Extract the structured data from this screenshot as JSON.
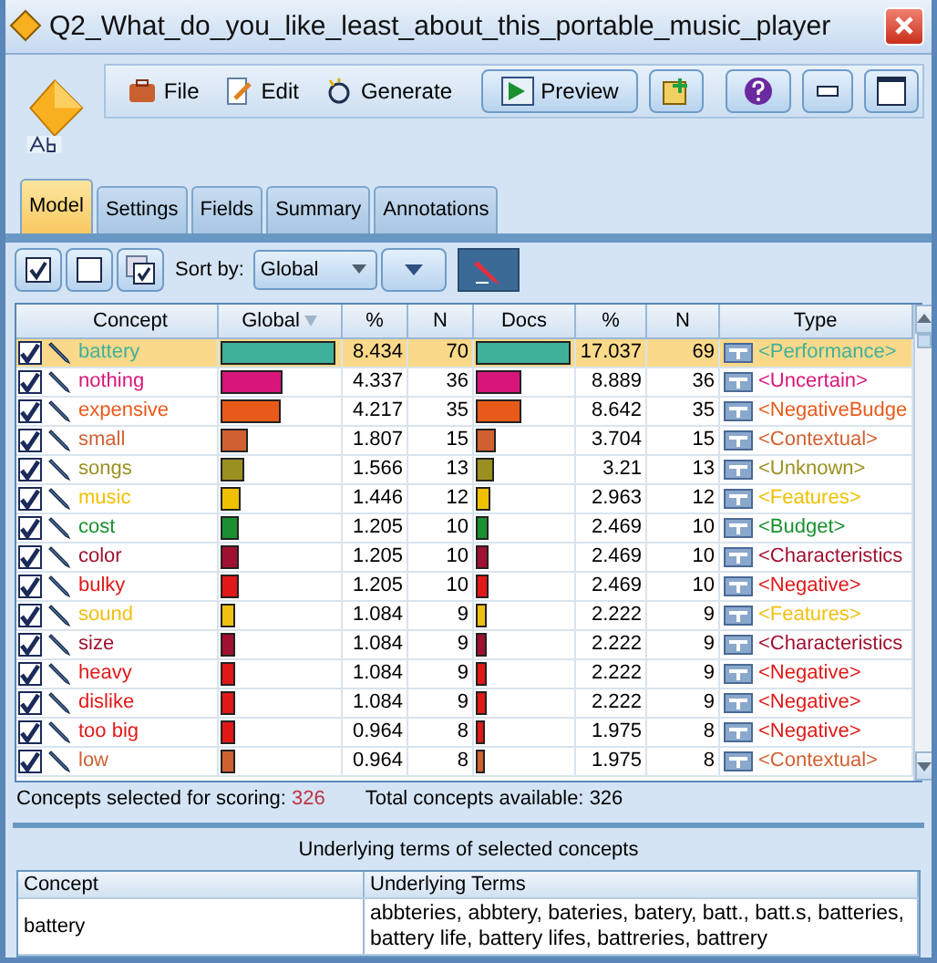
{
  "window": {
    "title": "Q2_What_do_you_like_least_about_this_portable_music_player"
  },
  "menu": [
    {
      "label": "File",
      "kind": "file"
    },
    {
      "label": "Edit",
      "kind": "edit"
    },
    {
      "label": "Generate",
      "kind": "generate"
    }
  ],
  "preview_button": {
    "label": "Preview"
  },
  "tabs": [
    {
      "label": "Model",
      "selected": true
    },
    {
      "label": "Settings",
      "selected": false
    },
    {
      "label": "Fields",
      "selected": false
    },
    {
      "label": "Summary",
      "selected": false
    },
    {
      "label": "Annotations",
      "selected": false
    }
  ],
  "sort": {
    "label": "Sort by:",
    "value": "Global"
  },
  "table": {
    "columns": [
      "Concept",
      "Global",
      "%",
      "N",
      "Docs",
      "%",
      "N",
      "Type"
    ],
    "rows": [
      {
        "concept": "battery",
        "color": "#3fb09a",
        "global_bar": {
          "level": 0.97
        },
        "pct": "8.434",
        "n": "70",
        "docs_bar": {
          "level": 0.98
        },
        "docs_pct": "17.037",
        "docs_n": "69",
        "type": "<Performance>",
        "checked": true,
        "selected": true
      },
      {
        "concept": "nothing",
        "color": "#d8157a",
        "global_bar": {
          "level": 0.52
        },
        "pct": "4.337",
        "n": "36",
        "docs_bar": {
          "level": 0.48
        },
        "docs_pct": "8.889",
        "docs_n": "36",
        "type": "<Uncertain>",
        "checked": true,
        "selected": false
      },
      {
        "concept": "expensive",
        "color": "#e85a1a",
        "global_bar": {
          "level": 0.5
        },
        "pct": "4.217",
        "n": "35",
        "docs_bar": {
          "level": 0.47
        },
        "docs_pct": "8.642",
        "docs_n": "35",
        "type": "<NegativeBudge",
        "checked": true,
        "selected": false
      },
      {
        "concept": "small",
        "color": "#d06030",
        "global_bar": {
          "level": 0.23
        },
        "pct": "1.807",
        "n": "15",
        "docs_bar": {
          "level": 0.2
        },
        "docs_pct": "3.704",
        "docs_n": "15",
        "type": "<Contextual>",
        "checked": true,
        "selected": false
      },
      {
        "concept": "songs",
        "color": "#9a9020",
        "global_bar": {
          "level": 0.2
        },
        "pct": "1.566",
        "n": "13",
        "docs_bar": {
          "level": 0.18
        },
        "docs_pct": "3.21",
        "docs_n": "13",
        "type": "<Unknown>",
        "checked": true,
        "selected": false
      },
      {
        "concept": "music",
        "color": "#f0c000",
        "global_bar": {
          "level": 0.17
        },
        "pct": "1.446",
        "n": "12",
        "docs_bar": {
          "level": 0.16
        },
        "docs_pct": "2.963",
        "docs_n": "12",
        "type": "<Features>",
        "checked": true,
        "selected": false
      },
      {
        "concept": "cost",
        "color": "#1a9030",
        "global_bar": {
          "level": 0.15
        },
        "pct": "1.205",
        "n": "10",
        "docs_bar": {
          "level": 0.14
        },
        "docs_pct": "2.469",
        "docs_n": "10",
        "type": "<Budget>",
        "checked": true,
        "selected": false
      },
      {
        "concept": "color",
        "color": "#a01030",
        "global_bar": {
          "level": 0.15
        },
        "pct": "1.205",
        "n": "10",
        "docs_bar": {
          "level": 0.14
        },
        "docs_pct": "2.469",
        "docs_n": "10",
        "type": "<Characteristics",
        "checked": true,
        "selected": false
      },
      {
        "concept": "bulky",
        "color": "#e01818",
        "global_bar": {
          "level": 0.15
        },
        "pct": "1.205",
        "n": "10",
        "docs_bar": {
          "level": 0.14
        },
        "docs_pct": "2.469",
        "docs_n": "10",
        "type": "<Negative>",
        "checked": true,
        "selected": false
      },
      {
        "concept": "sound",
        "color": "#f0c010",
        "global_bar": {
          "level": 0.13
        },
        "pct": "1.084",
        "n": "9",
        "docs_bar": {
          "level": 0.12
        },
        "docs_pct": "2.222",
        "docs_n": "9",
        "type": "<Features>",
        "checked": true,
        "selected": false
      },
      {
        "concept": "size",
        "color": "#a01030",
        "global_bar": {
          "level": 0.13
        },
        "pct": "1.084",
        "n": "9",
        "docs_bar": {
          "level": 0.12
        },
        "docs_pct": "2.222",
        "docs_n": "9",
        "type": "<Characteristics",
        "checked": true,
        "selected": false
      },
      {
        "concept": "heavy",
        "color": "#e01818",
        "global_bar": {
          "level": 0.13
        },
        "pct": "1.084",
        "n": "9",
        "docs_bar": {
          "level": 0.12
        },
        "docs_pct": "2.222",
        "docs_n": "9",
        "type": "<Negative>",
        "checked": true,
        "selected": false
      },
      {
        "concept": "dislike",
        "color": "#e01818",
        "global_bar": {
          "level": 0.13
        },
        "pct": "1.084",
        "n": "9",
        "docs_bar": {
          "level": 0.12
        },
        "docs_pct": "2.222",
        "docs_n": "9",
        "type": "<Negative>",
        "checked": true,
        "selected": false
      },
      {
        "concept": "too big",
        "color": "#e01818",
        "global_bar": {
          "level": 0.12
        },
        "pct": "0.964",
        "n": "8",
        "docs_bar": {
          "level": 0.1
        },
        "docs_pct": "1.975",
        "docs_n": "8",
        "type": "<Negative>",
        "checked": true,
        "selected": false
      },
      {
        "concept": "low",
        "color": "#d06030",
        "global_bar": {
          "level": 0.12
        },
        "pct": "0.964",
        "n": "8",
        "docs_bar": {
          "level": 0.1
        },
        "docs_pct": "1.975",
        "docs_n": "8",
        "type": "<Contextual>",
        "checked": true,
        "selected": false
      }
    ]
  },
  "status": {
    "selected_label": "Concepts selected for scoring:",
    "selected_value": "326",
    "total_label": "Total concepts available:",
    "total_value": "326"
  },
  "terms": {
    "title": "Underlying terms of selected concepts",
    "columns": [
      "Concept",
      "Underlying Terms"
    ],
    "rows": [
      {
        "concept": "battery",
        "terms": "abbteries, abbtery, bateries, batery, batt., batt.s, batteries, battery life, battery lifes, battreries, battrery"
      }
    ]
  }
}
